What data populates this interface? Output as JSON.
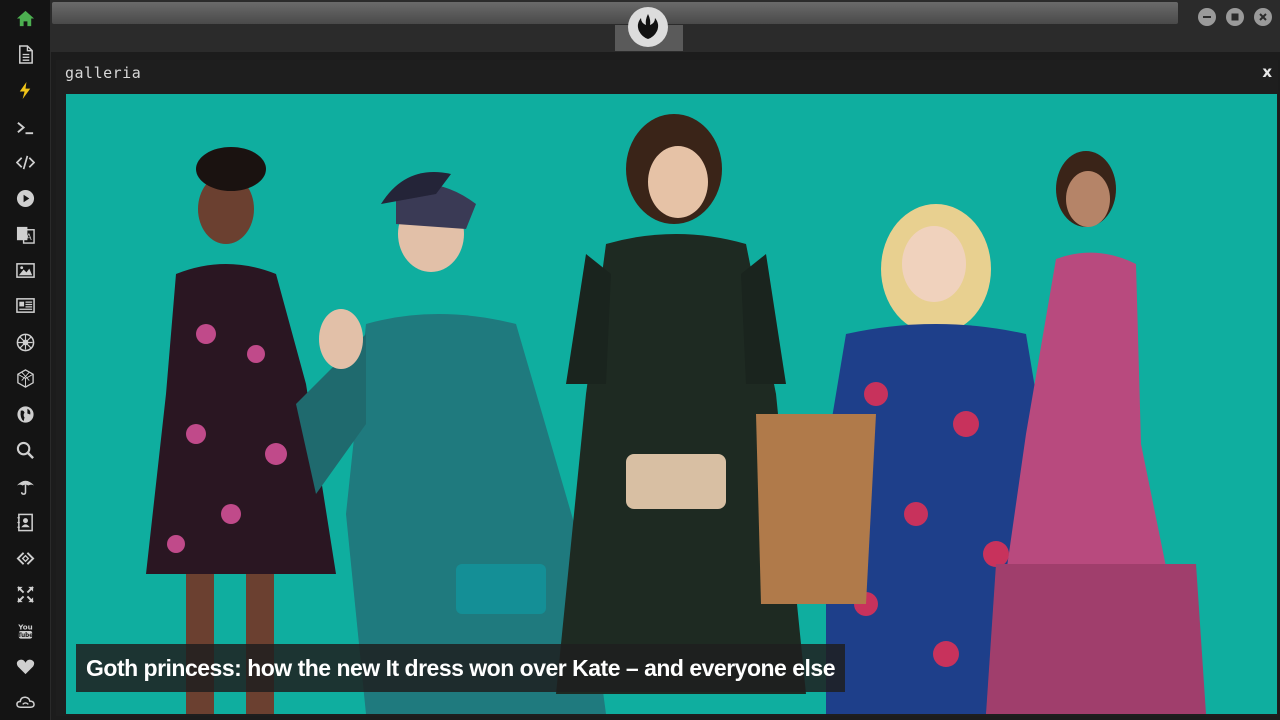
{
  "sidebar": {
    "items": [
      {
        "icon": "home-icon",
        "color": "#4caf50"
      },
      {
        "icon": "document-icon",
        "color": "#cfcfcf"
      },
      {
        "icon": "lightning-icon",
        "color": "#f0c419"
      },
      {
        "icon": "terminal-icon",
        "color": "#cfcfcf"
      },
      {
        "icon": "code-icon",
        "color": "#cfcfcf"
      },
      {
        "icon": "play-icon",
        "color": "#cfcfcf"
      },
      {
        "icon": "translate-icon",
        "color": "#cfcfcf"
      },
      {
        "icon": "image-icon",
        "color": "#cfcfcf"
      },
      {
        "icon": "newspaper-icon",
        "color": "#cfcfcf"
      },
      {
        "icon": "empire-icon",
        "color": "#cfcfcf"
      },
      {
        "icon": "cube-icon",
        "color": "#cfcfcf"
      },
      {
        "icon": "globe-icon",
        "color": "#cfcfcf"
      },
      {
        "icon": "search-icon",
        "color": "#cfcfcf"
      },
      {
        "icon": "umbrella-icon",
        "color": "#cfcfcf"
      },
      {
        "icon": "contact-icon",
        "color": "#cfcfcf"
      },
      {
        "icon": "link-icon",
        "color": "#cfcfcf"
      },
      {
        "icon": "expand-icon",
        "color": "#cfcfcf"
      },
      {
        "icon": "youtube-icon",
        "color": "#cfcfcf"
      },
      {
        "icon": "heart-icon",
        "color": "#cfcfcf"
      },
      {
        "icon": "cloud-icon",
        "color": "#cfcfcf"
      }
    ]
  },
  "window": {
    "buttons": [
      "minimize-icon",
      "maximize-icon",
      "close-icon"
    ],
    "logo": "rebel-alliance-icon"
  },
  "panel": {
    "title": "galleria",
    "close_label": "x",
    "caption": "Goth princess: how the new It dress won over Kate – and everyone else",
    "image_background": "#0fae9f"
  }
}
